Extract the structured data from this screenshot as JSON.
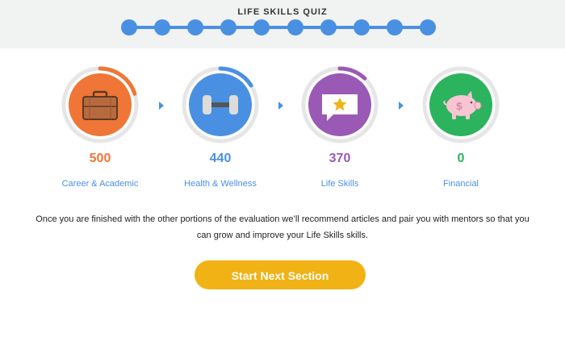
{
  "header": {
    "title": "LIFE SKILLS QUIZ",
    "progress_steps": 10
  },
  "categories": [
    {
      "name": "Career & Academic",
      "score": "500",
      "color": "#ef7637",
      "icon": "briefcase-icon",
      "progress": 0.2
    },
    {
      "name": "Health & Wellness",
      "score": "440",
      "color": "#4a90e2",
      "icon": "dumbbell-icon",
      "progress": 0.16
    },
    {
      "name": "Life Skills",
      "score": "370",
      "color": "#9b59b6",
      "icon": "star-message-icon",
      "progress": 0.12
    },
    {
      "name": "Financial",
      "score": "0",
      "color": "#2bb35e",
      "icon": "piggy-bank-icon",
      "progress": 0.0
    }
  ],
  "message": "Once you are finished with the other portions of the evaluation we’ll recommend articles and pair you with mentors so that you can grow and improve your Life Skills skills.",
  "start_button": {
    "label": "Start Next Section",
    "color": "#f0b215"
  }
}
